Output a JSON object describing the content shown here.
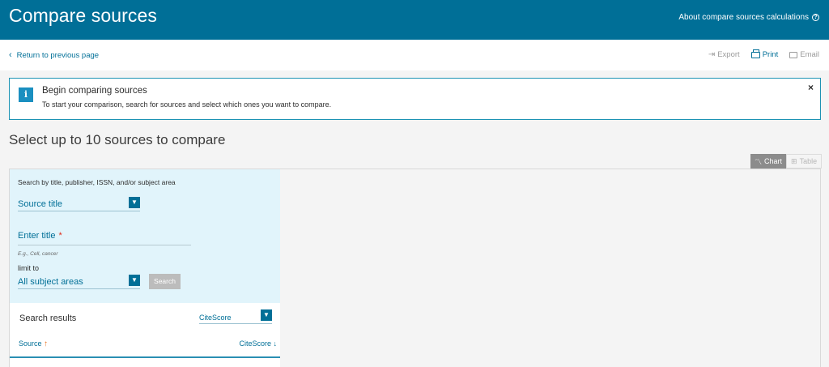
{
  "header": {
    "title": "Compare sources",
    "about_link": "About compare sources calculations"
  },
  "toolbar": {
    "back_link": "Return to previous page",
    "export_label": "Export",
    "print_label": "Print",
    "email_label": "Email"
  },
  "info_banner": {
    "badge": "i",
    "heading": "Begin comparing sources",
    "body": "To start your comparison, search for sources and select which ones you want to compare.",
    "close": "×"
  },
  "section_title": "Select up to 10 sources to compare",
  "view_toggle": {
    "chart_label": "Chart",
    "table_label": "Table"
  },
  "search": {
    "hint": "Search by title, publisher, ISSN, and/or subject area",
    "search_type": "Source title",
    "title_placeholder": "Enter title",
    "required_marker": "*",
    "example": "E.g., Cell, cancer",
    "limit_label": "limit to",
    "subject_area": "All subject areas",
    "search_button": "Search"
  },
  "results": {
    "title": "Search results",
    "metric": "CiteScore",
    "col_source": "Source",
    "col_source_sort": "↑",
    "col_citescore": "CiteScore",
    "col_citescore_sort": "↓"
  },
  "colors": {
    "header_bg": "#006f97",
    "link": "#006f97",
    "panel_bg": "#e1f4fb",
    "info_border": "#1d93b4",
    "required": "#e0301e",
    "sort_active": "#e9711c"
  }
}
